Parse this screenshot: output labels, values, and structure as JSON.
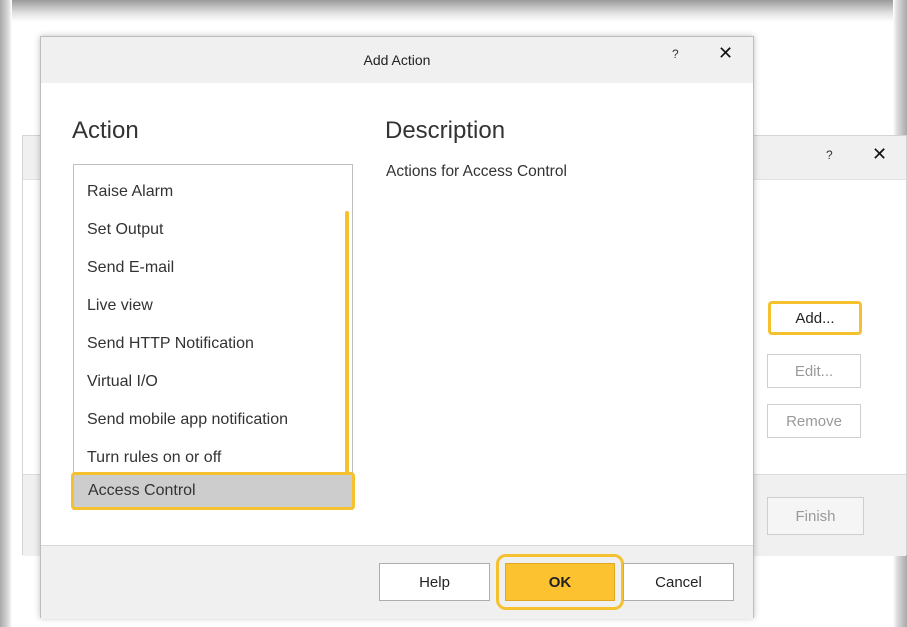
{
  "background_dialog": {
    "help_glyph": "?",
    "close_glyph": "✕",
    "buttons": {
      "add": "Add...",
      "edit": "Edit...",
      "remove": "Remove",
      "finish": "Finish"
    }
  },
  "dialog": {
    "title": "Add Action",
    "help_glyph": "?",
    "close_glyph": "✕",
    "action_heading": "Action",
    "description_heading": "Description",
    "description_text": "Actions for Access Control",
    "actions": [
      "Raise Alarm",
      "Set Output",
      "Send E-mail",
      "Live view",
      "Send HTTP Notification",
      "Virtual I/O",
      "Send mobile app notification",
      "Turn rules on or off",
      "Access Control"
    ],
    "selected_action": "Access Control",
    "buttons": {
      "help": "Help",
      "ok": "OK",
      "cancel": "Cancel"
    }
  },
  "colors": {
    "highlight": "#f5c12f",
    "ok_button": "#fdc22f",
    "selected_row": "#cdcdcd",
    "titlebar": "#f0f0f0"
  }
}
